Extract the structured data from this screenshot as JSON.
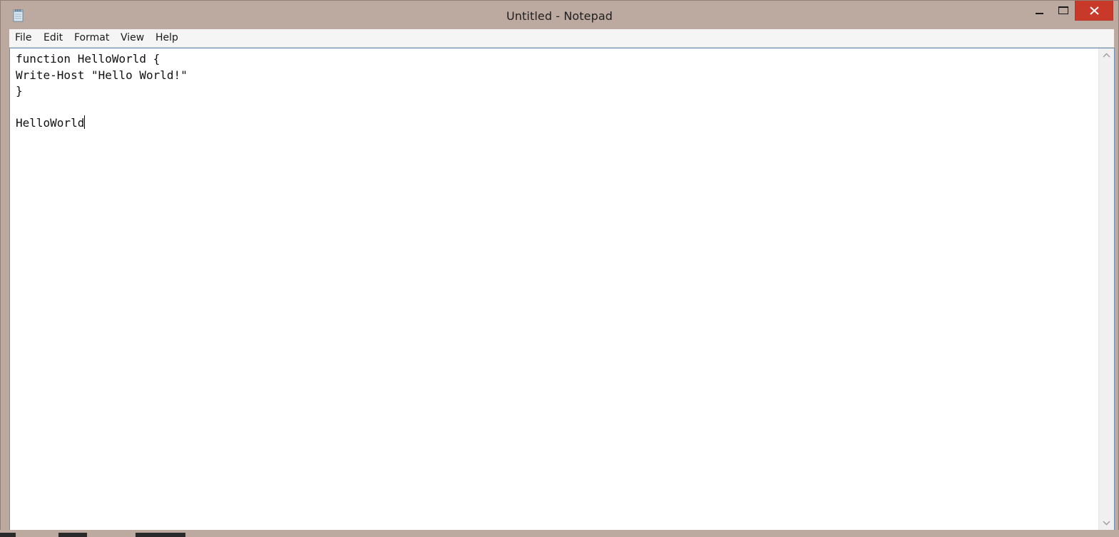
{
  "window": {
    "title": "Untitled - Notepad",
    "colors": {
      "frame": "#bca99f",
      "close": "#c8392a",
      "editor_border": "#6d8fb4"
    }
  },
  "titlebar": {
    "icon": "notepad-icon",
    "minimize_icon": "minimize-icon",
    "maximize_icon": "maximize-icon",
    "close_icon": "close-icon"
  },
  "menu": {
    "file": "File",
    "edit": "Edit",
    "format": "Format",
    "view": "View",
    "help": "Help"
  },
  "editor": {
    "lines": [
      "function HelloWorld {",
      "Write-Host \"Hello World!\"",
      "}",
      "",
      "HelloWorld"
    ]
  },
  "scrollbar": {
    "up_icon": "scroll-up-arrow-icon",
    "down_icon": "scroll-down-arrow-icon"
  }
}
